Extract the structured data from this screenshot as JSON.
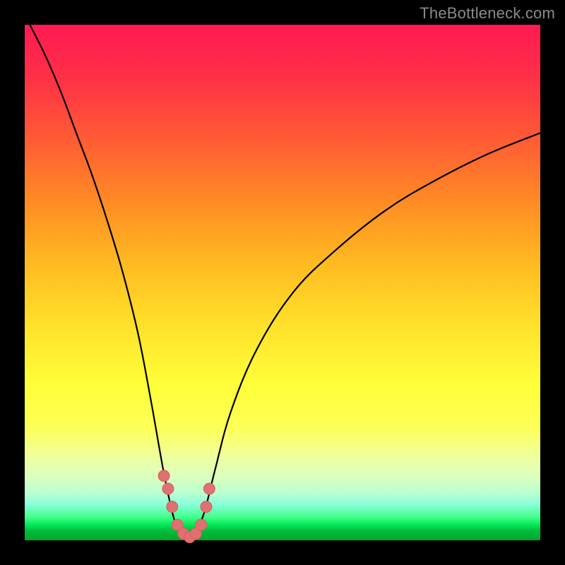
{
  "watermark": "TheBottleneck.com",
  "colors": {
    "page_bg": "#000000",
    "curve_stroke": "#000000",
    "marker_fill": "#e17070",
    "marker_stroke": "#d85f5f"
  },
  "chart_data": {
    "type": "line",
    "title": "",
    "xlabel": "",
    "ylabel": "",
    "xlim": [
      0,
      100
    ],
    "ylim": [
      0,
      100
    ],
    "grid": false,
    "legend": false,
    "series": [
      {
        "name": "bottleneck-curve",
        "x": [
          1,
          4,
          7,
          10,
          13,
          16,
          19,
          22,
          24.5,
          27,
          29,
          30.5,
          31.5,
          32.5,
          33.5,
          35,
          37,
          40,
          45,
          52,
          60,
          70,
          80,
          90,
          100
        ],
        "y": [
          100,
          94,
          87,
          79,
          71,
          62,
          52,
          40,
          27,
          13,
          4,
          1,
          0,
          0.5,
          2,
          6,
          14,
          25,
          37,
          48,
          56,
          64,
          70,
          75,
          79
        ]
      }
    ],
    "markers": {
      "name": "highlight-points",
      "x": [
        27.0,
        27.8,
        28.6,
        29.6,
        30.8,
        32.0,
        33.2,
        34.2,
        35.2,
        35.8
      ],
      "y": [
        12.5,
        10.0,
        6.5,
        3.0,
        1.3,
        0.6,
        1.3,
        3.0,
        6.5,
        10.0
      ]
    }
  }
}
